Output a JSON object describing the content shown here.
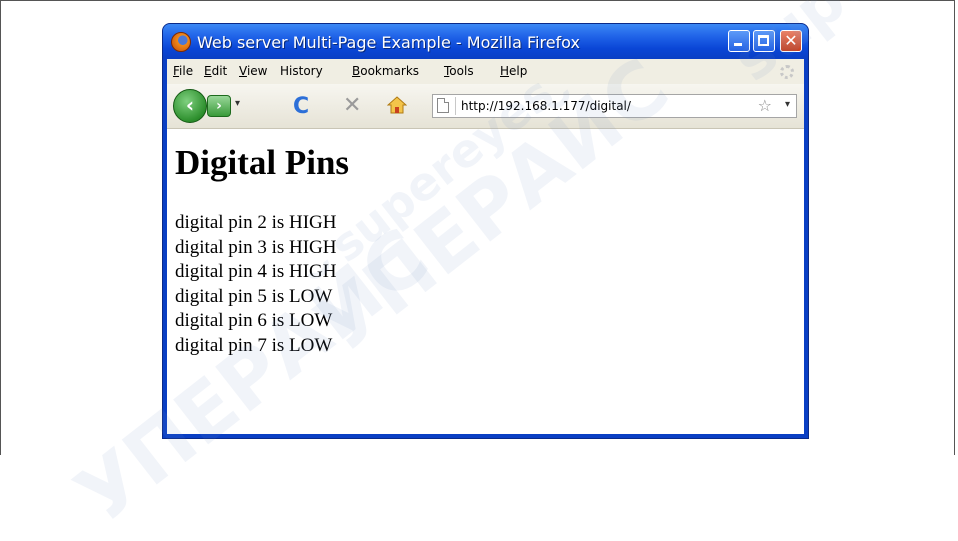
{
  "window": {
    "title": "Web server Multi-Page Example - Mozilla Firefox",
    "close_glyph": "✕"
  },
  "menu": [
    {
      "label": "File",
      "accel": "F",
      "rest": "ile"
    },
    {
      "label": "Edit",
      "accel": "E",
      "rest": "dit"
    },
    {
      "label": "View",
      "accel": "V",
      "rest": "iew"
    },
    {
      "label": "History",
      "accel": "",
      "rest": "History"
    },
    {
      "label": "Bookmarks",
      "accel": "B",
      "rest": "ookmarks"
    },
    {
      "label": "Tools",
      "accel": "T",
      "rest": "ools"
    },
    {
      "label": "Help",
      "accel": "H",
      "rest": "elp"
    }
  ],
  "nav": {
    "back_glyph": "‹",
    "forward_glyph": "›",
    "dropdown_glyph": "▾",
    "reload_glyph": "C",
    "stop_glyph": "✕",
    "url": "http://192.168.1.177/digital/",
    "star_glyph": "☆"
  },
  "page": {
    "heading": "Digital Pins",
    "pins": [
      "digital pin 2 is HIGH",
      "digital pin 3 is HIGH",
      "digital pin 4 is HIGH",
      "digital pin 5 is LOW",
      "digital pin 6 is LOW",
      "digital pin 7 is LOW"
    ]
  },
  "watermark": {
    "lines": [
      "supereyes",
      "УПЕРАЙС",
      "УПЕРАЙС",
      "supereyes"
    ]
  },
  "colors": {
    "titlebar": "#0a3fc4",
    "menubar": "#f0eee3",
    "accent_green": "#2d8f2d"
  }
}
